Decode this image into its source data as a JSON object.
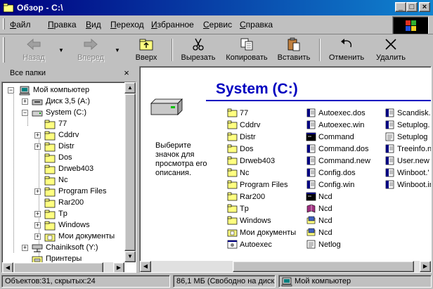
{
  "window": {
    "title": "Обзор - C:\\"
  },
  "menu": [
    "Файл",
    "Правка",
    "Вид",
    "Переход",
    "Избранное",
    "Сервис",
    "Справка"
  ],
  "toolbar": {
    "back": "Назад",
    "forward": "Вперед",
    "up": "Вверх",
    "cut": "Вырезать",
    "copy": "Копировать",
    "paste": "Вставить",
    "undo": "Отменить",
    "delete": "Удалить"
  },
  "folders_pane": {
    "header": "Все папки",
    "tree": [
      "Мой компьютер",
      "Диск 3,5 (A:)",
      "System (C:)",
      "77",
      "Cddrv",
      "Distr",
      "Dos",
      "Drweb403",
      "Nc",
      "Program Files",
      "Rar200",
      "Tp",
      "Windows",
      "Мои документы",
      "Chainiksoft (Y:)",
      "Принтеры"
    ]
  },
  "content": {
    "title": "System (C:)",
    "description": "Выберите значок для просмотра его описания.",
    "columns": [
      [
        {
          "name": "77",
          "icon": "folder-icon"
        },
        {
          "name": "Cddrv",
          "icon": "folder-icon"
        },
        {
          "name": "Distr",
          "icon": "folder-icon"
        },
        {
          "name": "Dos",
          "icon": "folder-icon"
        },
        {
          "name": "Drweb403",
          "icon": "folder-icon"
        },
        {
          "name": "Nc",
          "icon": "folder-icon"
        },
        {
          "name": "Program Files",
          "icon": "folder-icon"
        },
        {
          "name": "Rar200",
          "icon": "folder-icon"
        },
        {
          "name": "Tp",
          "icon": "folder-icon"
        },
        {
          "name": "Windows",
          "icon": "folder-icon"
        },
        {
          "name": "Мои документы",
          "icon": "my-documents-icon"
        },
        {
          "name": "Autoexec",
          "icon": "msdos-program-icon"
        }
      ],
      [
        {
          "name": "Autoexec.dos",
          "icon": "text-file-icon"
        },
        {
          "name": "Autoexec.win",
          "icon": "text-file-icon"
        },
        {
          "name": "Command",
          "icon": "msdos-window-icon"
        },
        {
          "name": "Command.dos",
          "icon": "text-file-icon"
        },
        {
          "name": "Command.new",
          "icon": "text-file-icon"
        },
        {
          "name": "Config.dos",
          "icon": "text-file-icon"
        },
        {
          "name": "Config.win",
          "icon": "text-file-icon"
        },
        {
          "name": "Ncd",
          "icon": "msdos-window-icon"
        },
        {
          "name": "Ncd",
          "icon": "book-icon"
        },
        {
          "name": "Ncd",
          "icon": "setup-icon"
        },
        {
          "name": "Ncd",
          "icon": "setup-icon"
        },
        {
          "name": "Netlog",
          "icon": "notepad-icon"
        }
      ],
      [
        {
          "name": "Scandisk.",
          "icon": "text-file-icon"
        },
        {
          "name": "Setuplog.",
          "icon": "text-file-icon"
        },
        {
          "name": "Setuplog",
          "icon": "notepad-icon"
        },
        {
          "name": "Treeinfo.n",
          "icon": "text-file-icon"
        },
        {
          "name": "User.new",
          "icon": "text-file-icon"
        },
        {
          "name": "Winboot.'",
          "icon": "text-file-icon"
        },
        {
          "name": "Winboot.in",
          "icon": "text-file-icon"
        }
      ]
    ]
  },
  "status": {
    "objects": "Объектов:31, скрытых:24",
    "free_space": "86,1 МБ (Свободно на диске",
    "location": "Мой компьютер"
  }
}
